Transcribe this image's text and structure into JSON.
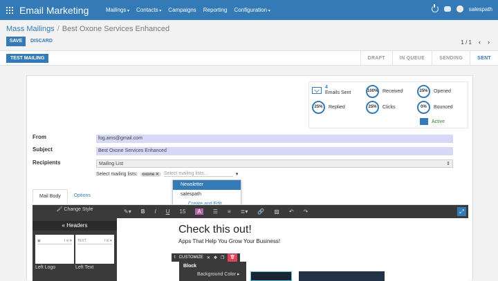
{
  "app": {
    "title": "Email Marketing",
    "menu": [
      "Mailings",
      "Contacts",
      "Campaigns",
      "Reporting",
      "Configuration"
    ],
    "user": "salespath"
  },
  "breadcrumb": {
    "parent": "Mass Mailings",
    "current": "Best Oxone Services Enhanced"
  },
  "actions": {
    "save": "SAVE",
    "discard": "DISCARD"
  },
  "pager": {
    "text": "1 / 1",
    "prev": "‹",
    "next": "›"
  },
  "status": {
    "test_button": "TEST MAILING",
    "stages": [
      "DRAFT",
      "IN QUEUE",
      "SENDING",
      "SENT"
    ],
    "active_stage": "SENT"
  },
  "stats": {
    "sent_count": "4",
    "sent_label": "Emails Sent",
    "received": {
      "value": "100%",
      "label": "Received"
    },
    "opened": {
      "value": "25%",
      "label": "Opened"
    },
    "replied": {
      "value": "25%",
      "label": "Replied"
    },
    "clicks": {
      "value": "25%",
      "label": "Clicks"
    },
    "bounced": {
      "value": "0%",
      "label": "Bounced"
    },
    "active": "Active"
  },
  "form": {
    "from_label": "From",
    "from_value": "fog.ams@gmail.com",
    "subject_label": "Subject",
    "subject_value": "Best Oxone Services Enhanced",
    "recipients_label": "Recipients",
    "recipients_value": "Mailing List",
    "mailing_lists_label": "Select mailing lists:",
    "mailing_list_tag": "oxone",
    "mailing_list_placeholder": "Select mailing lists...",
    "dropdown": [
      "Newsletter",
      "salespath",
      "Create and Edit..."
    ]
  },
  "tabs": [
    "Mail Body",
    "Options"
  ],
  "editor": {
    "change_style": "Change Style",
    "headers": "Headers",
    "thumb1_label": "Left Logo",
    "thumb2_label": "Left Text",
    "thumb2_text": "TEXT",
    "thumb_social": "f in ♥",
    "font_size": "15",
    "hero_title": "Check this out!",
    "hero_sub": "Apps That Help You Grow Your Business!",
    "customize": "CUSTOMIZE",
    "block": "Block",
    "background_color": "Background Color"
  }
}
